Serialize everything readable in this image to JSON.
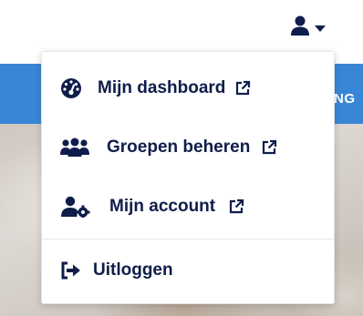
{
  "header": {
    "user_icon": "user-icon",
    "caret_icon": "caret-down-icon"
  },
  "banner": {
    "partial_text": "NG"
  },
  "menu": {
    "items": [
      {
        "label": "Mijn dashboard",
        "icon": "tachometer-icon",
        "external": true
      },
      {
        "label": "Groepen beheren",
        "icon": "users-icon",
        "external": true
      },
      {
        "label": "Mijn account",
        "icon": "user-cog-icon",
        "external": true
      }
    ],
    "logout": {
      "label": "Uitloggen",
      "icon": "sign-out-icon"
    }
  },
  "colors": {
    "primary_text": "#0f1d4a",
    "banner_blue": "#3a86d6",
    "menu_border": "#e3e6ea"
  }
}
